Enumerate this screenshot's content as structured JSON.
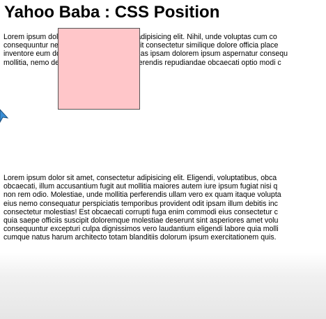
{
  "page": {
    "title": "Yahoo Baba : CSS Position"
  },
  "paragraph_1": {
    "lines": [
      "Lorem ipsum dolor sit amet, consectetur adipisicing elit. Nihil, unde voluptas cum co",
      "consequuntur nemo ipsum laboriosam velit consectetur similique dolore officia place",
      "inventore eum dolorum accusamus adi quas ipsam dolorem ipsum aspernatur consequ",
      "mollitia, nemo deleniti quibusdam illo perferendis repudiandae obcaecati optio modi c"
    ]
  },
  "paragraph_2": {
    "lines": [
      "Lorem ipsum dolor sit amet, consectetur adipisicing elit. Eligendi, voluptatibus, obca",
      "obcaecati, illum accusantium fugit aut mollitia maiores autem iure ipsum fugiat nisi q",
      "non rem odio. Molestiae, unde mollitia perferendis ullam vero ex quam itaque volupta",
      "eius nemo consequatur perspiciatis temporibus provident odit ipsam illum debitis inc",
      "consectetur molestias! Est obcaecati corrupti fuga enim commodi eius consectetur c",
      "quia saepe officiis suscipit doloremque molestiae deserunt sint asperiores amet volu",
      "consequuntur excepturi culpa dignissimos vero laudantium eligendi labore quia molli",
      "cumque natus harum architecto totam blanditiis dolorum ipsum exercitationem quis."
    ]
  },
  "colors": {
    "box_fill": "#ffc6c9",
    "box_border": "#555555",
    "pointer": "#3a8fd6"
  },
  "icons": {
    "pointer": "annotation-arrow-icon"
  }
}
